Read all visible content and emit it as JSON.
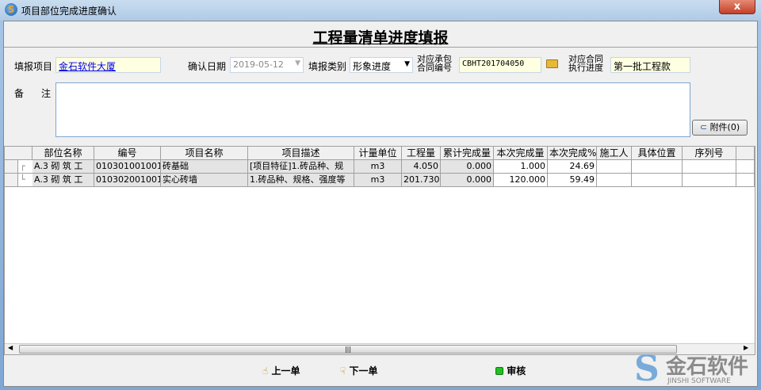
{
  "window": {
    "title": "项目部位完成进度确认",
    "close": "x"
  },
  "heading": "工程量清单进度填报",
  "form": {
    "project_label": "填报项目",
    "project_value": "金石软件大厦",
    "date_label": "确认日期",
    "date_value": "2019-05-12",
    "type_label": "填报类别",
    "type_value": "形象进度",
    "contract_label_1": "对应承包",
    "contract_label_2": "合同编号",
    "contract_value": "CBHT201704050",
    "progress_label_1": "对应合同",
    "progress_label_2": "执行进度",
    "progress_value": "第一批工程款",
    "memo_label_1": "备",
    "memo_label_2": "注",
    "memo_value": "",
    "attach_label": "附件(0)"
  },
  "table": {
    "headers": [
      "部位名称",
      "编号",
      "项目名称",
      "项目描述",
      "计量单位",
      "工程量",
      "累计完成量",
      "本次完成量",
      "本次完成%",
      "施工人",
      "具体位置",
      "序列号"
    ],
    "rows": [
      [
        "A.3 砌 筑 工",
        "010301001001",
        "砖基础",
        "[项目特征]1.砖品种、规",
        "m3",
        "4.050",
        "0.000",
        "1.000",
        "24.69",
        "",
        "",
        ""
      ],
      [
        "A.3 砌 筑 工",
        "010302001001",
        "实心砖墙",
        "1.砖品种、规格、强度等",
        "m3",
        "201.730",
        "0.000",
        "120.000",
        "59.49",
        "",
        "",
        ""
      ]
    ]
  },
  "buttons": {
    "prev": "上一单",
    "next": "下一单",
    "audit": "审核"
  },
  "logo": {
    "cn": "金石软件",
    "en": "JINSHI SOFTWARE"
  },
  "colors": {
    "memo_border": "#7ea6cf",
    "field_bg": "#ffffe1",
    "audit_green": "#22c022"
  }
}
